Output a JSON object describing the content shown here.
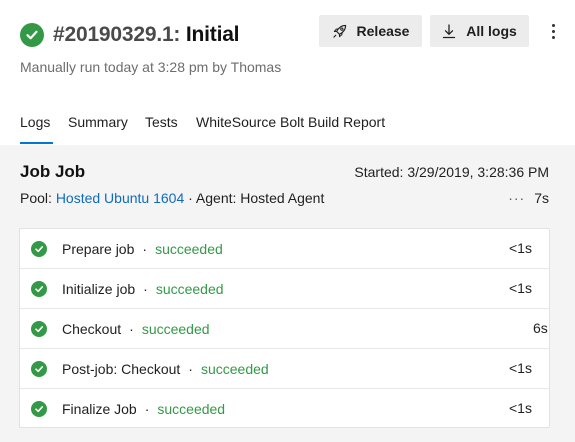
{
  "run": {
    "number": "#20190329.1:",
    "name": "Initial",
    "subtitle": "Manually run today at 3:28 pm by Thomas"
  },
  "actions": {
    "release_label": "Release",
    "all_logs_label": "All logs"
  },
  "tabs": [
    {
      "label": "Logs",
      "active": true
    },
    {
      "label": "Summary"
    },
    {
      "label": "Tests"
    },
    {
      "label": "WhiteSource Bolt Build Report"
    }
  ],
  "job": {
    "title": "Job Job",
    "started": "Started: 3/29/2019, 3:28:36 PM",
    "pool_label": "Pool:",
    "pool_name": "Hosted Ubuntu 1604",
    "agent": " · Agent: Hosted Agent",
    "more": "···",
    "duration": "7s"
  },
  "steps": [
    {
      "name": "Prepare job",
      "status": "succeeded",
      "time": "<1s"
    },
    {
      "name": "Initialize job",
      "status": "succeeded",
      "time": "<1s"
    },
    {
      "name": "Checkout",
      "status": "succeeded",
      "time": "6s"
    },
    {
      "name": "Post-job: Checkout",
      "status": "succeeded",
      "time": "<1s"
    },
    {
      "name": "Finalize Job",
      "status": "succeeded",
      "time": "<1s"
    }
  ],
  "separator": "·",
  "colors": {
    "success": "#339947",
    "accent": "#0078d4",
    "link": "#0f6cbd"
  },
  "icons": [
    "check-circle-icon",
    "rocket-icon",
    "download-icon",
    "more-vertical-icon",
    "more-horizontal-icon"
  ]
}
